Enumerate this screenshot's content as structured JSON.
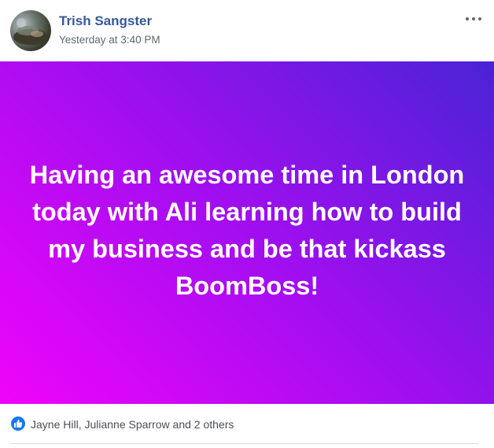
{
  "post": {
    "author_name": "Trish Sangster",
    "timestamp": "Yesterday at 3:40 PM",
    "more_icon": "more-horizontal-icon",
    "body_text": "Having an awesome time in London today with Ali learning how to build my business and be that kickass BoomBoss!",
    "background_gradient": [
      "#f004fa",
      "#a20ef0",
      "#4a23d6"
    ],
    "text_color": "#ffffff"
  },
  "reactions": {
    "icon": "like-thumbs-up-icon",
    "summary": "Jayne Hill, Julianne Sparrow and 2 others",
    "icon_color": "#1877f2"
  },
  "colors": {
    "author_name": "#385898",
    "timestamp": "#616770"
  }
}
